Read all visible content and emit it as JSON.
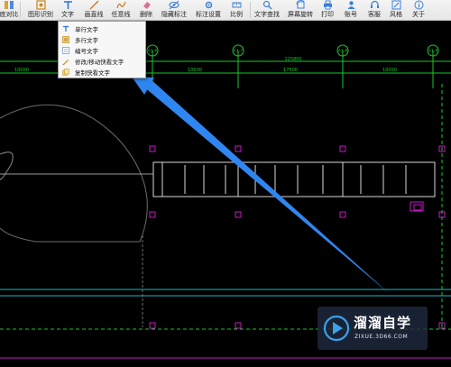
{
  "toolbar": {
    "items": [
      {
        "label": "底对比",
        "icon": "compare-icon"
      },
      {
        "label": "图形识别",
        "icon": "shape-recognition-icon"
      },
      {
        "label": "文字",
        "icon": "text-icon"
      },
      {
        "label": "画直线",
        "icon": "line-icon"
      },
      {
        "label": "任意线",
        "icon": "freehand-line-icon"
      },
      {
        "label": "删除",
        "icon": "eraser-icon"
      },
      {
        "label": "隐藏标注",
        "icon": "hide-eye-icon"
      },
      {
        "label": "标注设置",
        "icon": "annotation-settings-icon"
      },
      {
        "label": "比例",
        "icon": "scale-icon"
      },
      {
        "label": "文字查找",
        "icon": "text-search-icon"
      },
      {
        "label": "屏幕旋转",
        "icon": "rotate-screen-icon"
      },
      {
        "label": "打印",
        "icon": "printer-icon"
      },
      {
        "label": "账号",
        "icon": "account-icon"
      },
      {
        "label": "客服",
        "icon": "customer-service-icon"
      },
      {
        "label": "风格",
        "icon": "style-icon"
      },
      {
        "label": "关于",
        "icon": "info-icon"
      }
    ]
  },
  "text_menu": {
    "items": [
      {
        "label": "单行文字",
        "icon": "single-line-text-icon"
      },
      {
        "label": "多行文字",
        "icon": "multi-line-text-icon"
      },
      {
        "label": "编号文字",
        "icon": "numbered-text-icon"
      },
      {
        "label": "修改/移动快看文字",
        "icon": "edit-move-text-icon"
      },
      {
        "label": "复制快看文字",
        "icon": "copy-text-icon"
      }
    ]
  },
  "drawing": {
    "axis_labels": [
      "A1-6",
      "A1-7",
      "A1-8",
      "A1-9"
    ],
    "dimensions": [
      "10000",
      "10000",
      "10000",
      "17500",
      "10000"
    ],
    "total_dimension": "125800",
    "colors": {
      "background": "#000000",
      "axis_green": "#19c72a",
      "column_magenta": "#c21cc2",
      "wall_white": "#d9d9d9",
      "guide_cyan": "#1fb5c4",
      "arrow_blue": "#2f86f0"
    }
  },
  "watermark": {
    "name": "溜溜自学",
    "url": "ZIXUE.3D66.COM",
    "bg": "#1e2a3e",
    "accent": "#3aa0e8"
  }
}
